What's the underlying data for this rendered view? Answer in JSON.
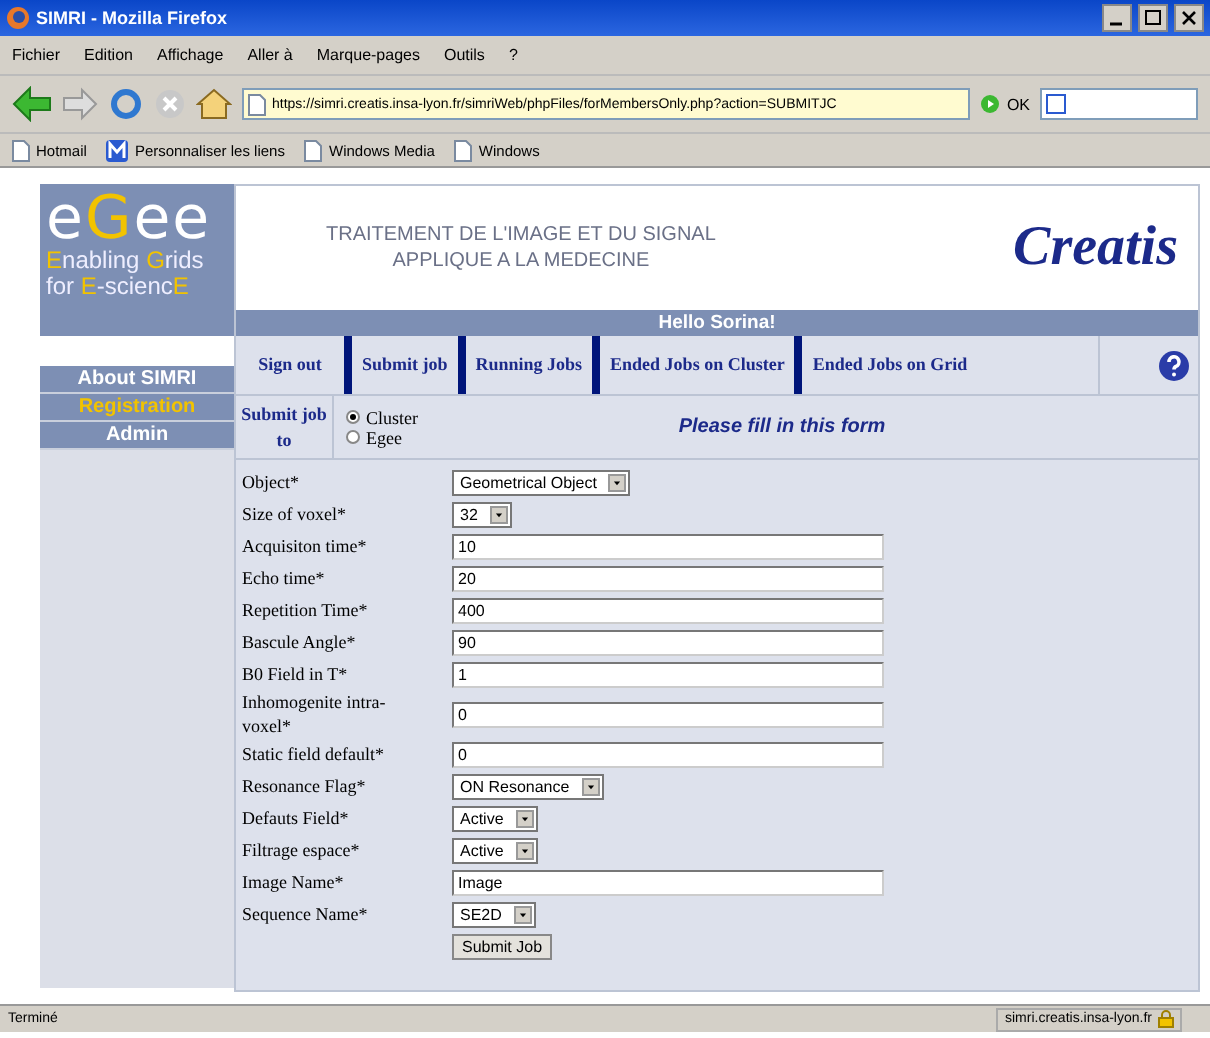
{
  "window": {
    "title": "SIMRI - Mozilla Firefox"
  },
  "menu": [
    "Fichier",
    "Edition",
    "Affichage",
    "Aller à",
    "Marque-pages",
    "Outils",
    "?"
  ],
  "toolbar": {
    "url": "https://simri.creatis.insa-lyon.fr/simriWeb/phpFiles/forMembersOnly.php?action=SUBMITJC",
    "go": "OK"
  },
  "bookmarks": [
    {
      "label": "Hotmail",
      "kind": "page"
    },
    {
      "label": "Personnaliser les liens",
      "kind": "brand"
    },
    {
      "label": "Windows Media",
      "kind": "page"
    },
    {
      "label": "Windows",
      "kind": "page"
    }
  ],
  "logo": {
    "mark": [
      {
        "t": "e",
        "hl": false
      },
      {
        "t": "G",
        "hl": true
      },
      {
        "t": "ee",
        "hl": false
      }
    ],
    "lines": [
      [
        {
          "t": "E",
          "hl": true
        },
        {
          "t": "nabling ",
          "hl": false
        },
        {
          "t": "G",
          "hl": true
        },
        {
          "t": "rids",
          "hl": false
        }
      ],
      [
        {
          "t": "for ",
          "hl": false
        },
        {
          "t": "E",
          "hl": true
        },
        {
          "t": "-scienc",
          "hl": false
        },
        {
          "t": "E",
          "hl": true
        }
      ]
    ]
  },
  "sidebar": {
    "items": [
      {
        "label": "About SIMRI",
        "selected": false
      },
      {
        "label": "Registration",
        "selected": true
      },
      {
        "label": "Admin",
        "selected": false
      }
    ]
  },
  "header": {
    "title_lines": [
      "TRAITEMENT DE L'IMAGE ET DU SIGNAL",
      "APPLIQUE A LA MEDECINE"
    ],
    "brand": "Creatis"
  },
  "greeting": "Hello Sorina!",
  "nav": [
    {
      "label": "Sign out"
    },
    {
      "label": "Submit job"
    },
    {
      "label": "Running Jobs"
    },
    {
      "label": "Ended Jobs on Cluster"
    },
    {
      "label": "Ended Jobs on Grid"
    }
  ],
  "submit_to": {
    "label": "Submit job to",
    "options": [
      {
        "label": "Cluster",
        "selected": true
      },
      {
        "label": "Egee",
        "selected": false
      }
    ],
    "hint": "Please fill in this form"
  },
  "form": [
    {
      "label": "Object*",
      "kind": "select",
      "value": "Geometrical Object"
    },
    {
      "label": "Size of voxel*",
      "kind": "select",
      "value": "32"
    },
    {
      "label": "Acquisiton time*",
      "kind": "text",
      "value": "10"
    },
    {
      "label": "Echo time*",
      "kind": "text",
      "value": "20"
    },
    {
      "label": "Repetition Time*",
      "kind": "text",
      "value": "400"
    },
    {
      "label": "Bascule Angle*",
      "kind": "text",
      "value": "90"
    },
    {
      "label": "B0 Field in T*",
      "kind": "text",
      "value": "1"
    },
    {
      "label": "Inhomogenite intra-voxel*",
      "kind": "text",
      "value": "0"
    },
    {
      "label": "Static field default*",
      "kind": "text",
      "value": "0"
    },
    {
      "label": "Resonance Flag*",
      "kind": "select",
      "value": "ON Resonance"
    },
    {
      "label": "Defauts Field*",
      "kind": "select",
      "value": "Active"
    },
    {
      "label": "Filtrage espace*",
      "kind": "select",
      "value": "Active"
    },
    {
      "label": "Image Name*",
      "kind": "text",
      "value": "Image"
    },
    {
      "label": "Sequence Name*",
      "kind": "select",
      "value": "SE2D"
    }
  ],
  "submit_button": "Submit Job",
  "status_bar": {
    "text": "Terminé",
    "host": "simri.creatis.insa-lyon.fr"
  }
}
